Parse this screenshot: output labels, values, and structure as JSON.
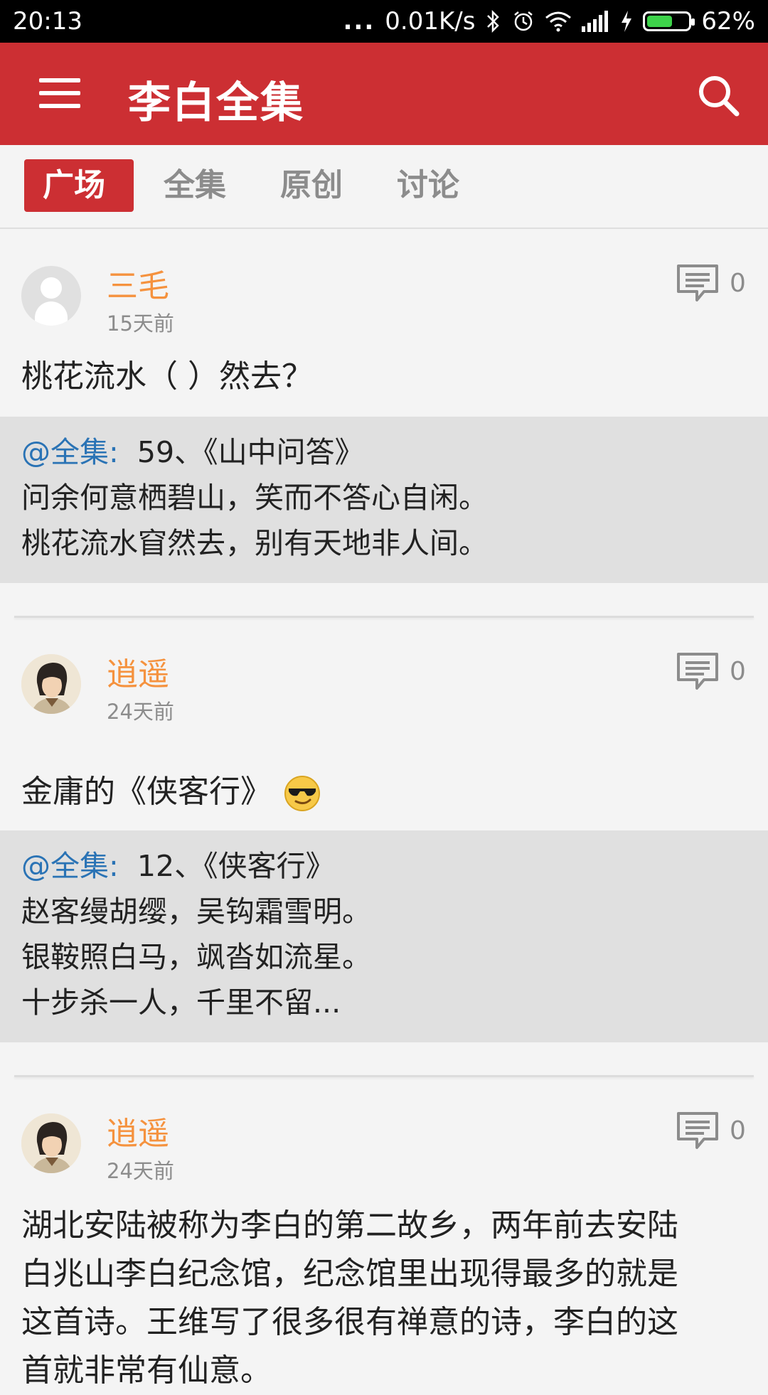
{
  "status_bar": {
    "time": "20:13",
    "dots": "...",
    "net_speed": "0.01K/s",
    "battery": "62%",
    "battery_level": 0.62
  },
  "app_bar": {
    "title": "李白全集"
  },
  "tabs": [
    {
      "label": "广场",
      "active": true
    },
    {
      "label": "全集",
      "active": false
    },
    {
      "label": "原创",
      "active": false
    },
    {
      "label": "讨论",
      "active": false
    }
  ],
  "posts": [
    {
      "author": "三毛",
      "time": "15天前",
      "comments": "0",
      "text": "桃花流水（ ）然去？",
      "quote": {
        "at": "@全集:",
        "title": "59、《山中问答》",
        "lines": [
          "问余何意栖碧山，笑而不答心自闲。",
          "桃花流水窅然去，别有天地非人间。"
        ]
      }
    },
    {
      "author": "逍遥",
      "time": "24天前",
      "comments": "0",
      "text": "金庸的《侠客行》",
      "quote": {
        "at": "@全集:",
        "title": "12、《侠客行》",
        "lines": [
          "赵客缦胡缨，吴钩霜雪明。",
          "银鞍照白马，飒沓如流星。",
          "十步杀一人，千里不留..."
        ]
      }
    },
    {
      "author": "逍遥",
      "time": "24天前",
      "comments": "0",
      "text_lines": [
        "湖北安陆被称为李白的第二故乡，两年前去安陆",
        "白兆山李白纪念馆，纪念馆里出现得最多的就是",
        "这首诗。王维写了很多很有禅意的诗，李白的这",
        "首就非常有仙意。"
      ]
    }
  ],
  "colors": {
    "accent": "#cc2f33",
    "author": "#f5923e",
    "mention": "#2a73b5"
  }
}
